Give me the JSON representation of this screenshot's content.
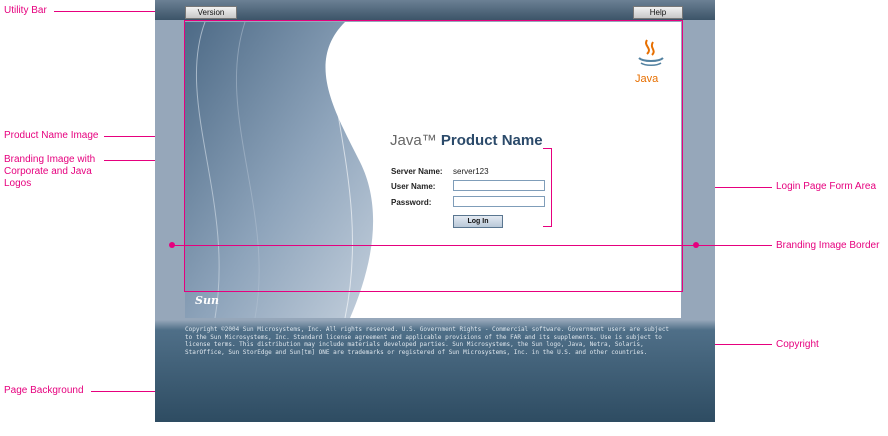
{
  "callouts": {
    "utility_bar": "Utility Bar",
    "product_name_image": "Product Name Image",
    "branding_image": "Branding Image with Corporate and Java Logos",
    "page_background": "Page Background",
    "login_form_area": "Login Page Form Area",
    "branding_border": "Branding Image Border",
    "copyright": "Copyright"
  },
  "utility_bar": {
    "version_label": "Version",
    "help_label": "Help"
  },
  "product": {
    "java": "Java™",
    "name": "Product Name"
  },
  "form": {
    "server_label": "Server Name:",
    "server_value": "server123",
    "user_label": "User Name:",
    "password_label": "Password:",
    "login_button": "Log In"
  },
  "logos": {
    "java": "Java",
    "sun": "Sun"
  },
  "copyright_text": "Copyright ©2004 Sun Microsystems, Inc. All rights reserved. U.S. Government Rights - Commercial software. Government users are subject to the Sun Microsystems, Inc. Standard license agreement and applicable provisions of the FAR and its supplements. Use is subject to license terms. This distribution may include materials developed parties. Sun Microsystems, the Sun logo, Java, Netra, Solaris, StarOffice, Sun StorEdge and Sun[tm] ONE are trademarks or registered of Sun Microsystems, Inc. in the U.S. and other countries.",
  "colors": {
    "callout": "#e6007e",
    "accent": "#2b4a6a",
    "java_orange": "#e76f00"
  }
}
